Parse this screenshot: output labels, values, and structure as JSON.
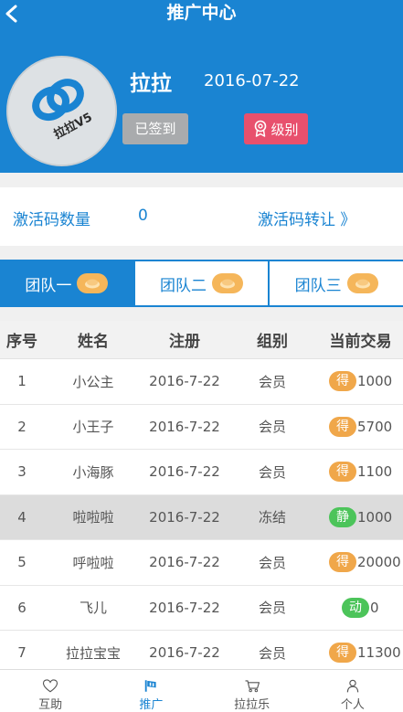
{
  "header": {
    "title": "推广中心",
    "user_name": "拉拉",
    "date": "2016-07-22",
    "checkin_label": "已签到",
    "level_label": "级别",
    "avatar_text": "拉拉V5"
  },
  "activation": {
    "label": "激活码数量",
    "count": "0",
    "transfer_label": "激活码转让 》"
  },
  "tabs": [
    {
      "label": "团队一",
      "active": true
    },
    {
      "label": "团队二",
      "active": false
    },
    {
      "label": "团队三",
      "active": false
    }
  ],
  "table": {
    "headers": [
      "序号",
      "姓名",
      "注册",
      "组别",
      "当前交易"
    ],
    "rows": [
      {
        "no": "1",
        "name": "小公主",
        "date": "2016-7-22",
        "group": "会员",
        "badge": "得",
        "amount": "1000"
      },
      {
        "no": "2",
        "name": "小王子",
        "date": "2016-7-22",
        "group": "会员",
        "badge": "得",
        "amount": "5700"
      },
      {
        "no": "3",
        "name": "小海豚",
        "date": "2016-7-22",
        "group": "会员",
        "badge": "得",
        "amount": "1100"
      },
      {
        "no": "4",
        "name": "啦啦啦",
        "date": "2016-7-22",
        "group": "冻结",
        "badge": "静",
        "amount": "1000"
      },
      {
        "no": "5",
        "name": "呼啦啦",
        "date": "2016-7-22",
        "group": "会员",
        "badge": "得",
        "amount": "20000"
      },
      {
        "no": "6",
        "name": "飞儿",
        "date": "2016-7-22",
        "group": "会员",
        "badge": "动",
        "amount": "0"
      },
      {
        "no": "7",
        "name": "拉拉宝宝",
        "date": "2016-7-22",
        "group": "会员",
        "badge": "得",
        "amount": "11300"
      }
    ]
  },
  "colors": {
    "primary": "#1a84d2",
    "badge_orange": "#f0a74a",
    "badge_green": "#4cc45a",
    "level_pink": "#e8506d"
  },
  "bottom_nav": [
    {
      "label": "互助",
      "icon": "heart-icon"
    },
    {
      "label": "推广",
      "icon": "promotion-icon"
    },
    {
      "label": "拉拉乐",
      "icon": "cart-icon"
    },
    {
      "label": "个人",
      "icon": "person-icon"
    }
  ]
}
